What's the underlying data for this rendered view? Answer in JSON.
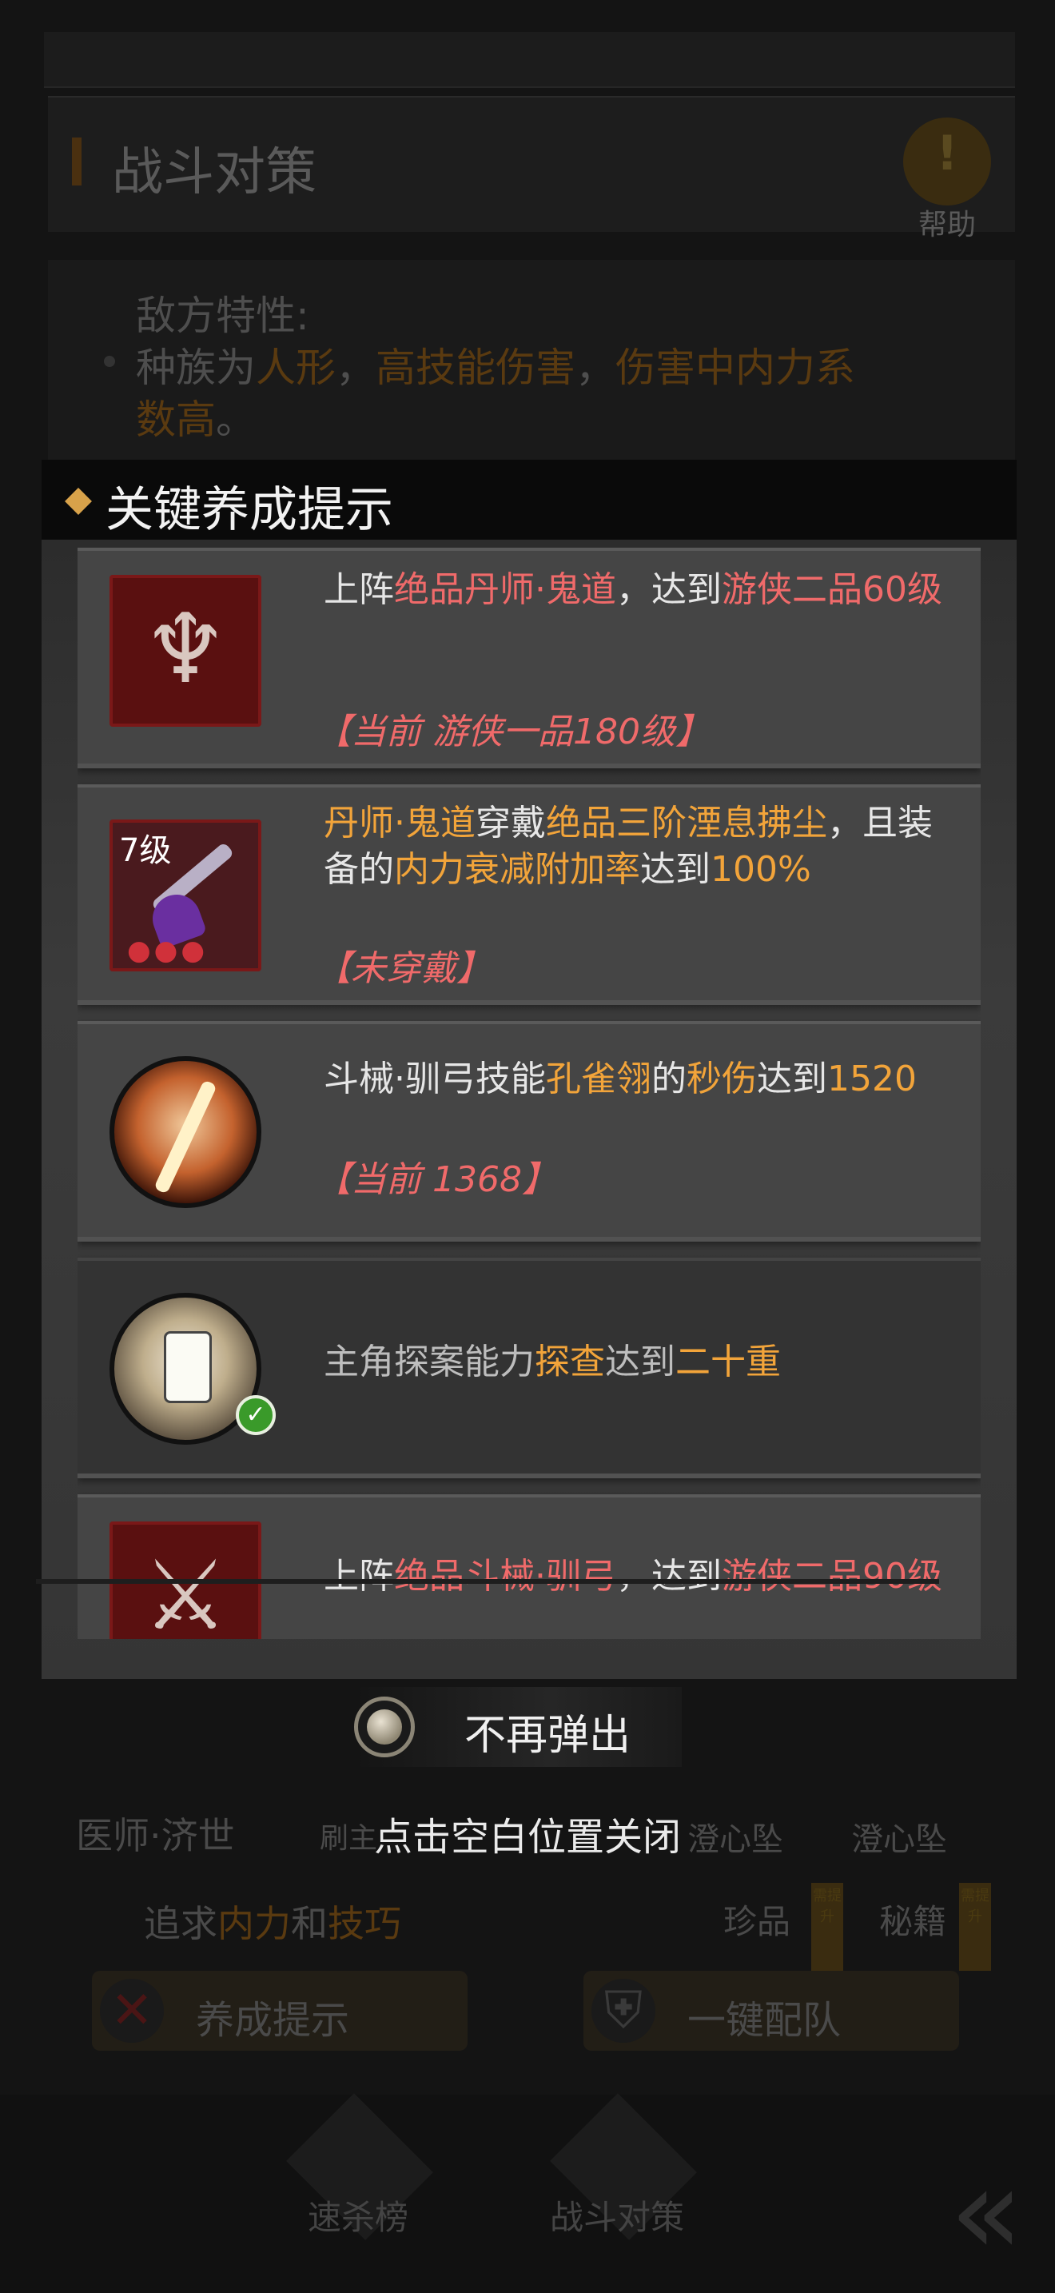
{
  "background": {
    "header_title": "战斗对策",
    "help_label": "帮助",
    "enemy_traits": {
      "label": "敌方特性:",
      "line1_prefix": "种族为",
      "race": "人形",
      "sep1": "，",
      "trait_a": "高技能伤害",
      "sep2": "，",
      "trait_b": "伤害中内力系",
      "line2_cont": "数高",
      "line2_end": "。"
    },
    "role_left": "医师·济世",
    "role_mid1": "刷主",
    "role_mid2": "澄心坠",
    "role_right": "澄心坠",
    "pursuit_prefix": "追求",
    "pursuit_a": "内力",
    "pursuit_and": "和",
    "pursuit_b": "技巧",
    "tag_treasure": "珍品",
    "tag_manual": "秘籍",
    "mini_tag": "需提升",
    "btn_cultivate": "养成提示",
    "btn_auto_team": "一键配队",
    "nav_ranking": "速杀榜",
    "nav_strategy": "战斗对策"
  },
  "modal": {
    "title": "关键养成提示",
    "cards": [
      {
        "icon": "guidao-emblem-icon",
        "t1": "上阵",
        "t2": "绝品丹师·鬼道",
        "t3": "，达到",
        "t4": "游侠二品60级",
        "status": "【当前 游侠一品180级】"
      },
      {
        "icon": "whisk-weapon-icon",
        "level": "7级",
        "t1": "丹师·鬼道",
        "t2": "穿戴",
        "t3": "绝品三阶湮息拂尘",
        "t4": "，且装备的",
        "t5": "内力衰减附加率",
        "t6": "达到",
        "t7": "100%",
        "status": "【未穿戴】"
      },
      {
        "icon": "peacock-feather-skill-icon",
        "t1": "斗械·驯弓技能",
        "t2": "孔雀翎",
        "t3": "的",
        "t4": "秒伤",
        "t5": "达到",
        "t6": "1520",
        "status": "【当前 1368】"
      },
      {
        "icon": "investigation-lantern-icon",
        "t1": "主角探案能力",
        "t2": "探查",
        "t3": "达到",
        "t4": "二十重"
      },
      {
        "icon": "xungong-emblem-icon",
        "t1": "上阵",
        "t2": "绝品斗械·驯弓",
        "t3": "，达到",
        "t4": "游侠二品90级"
      }
    ],
    "no_popup_label": "不再弹出",
    "close_hint": "点击空白位置关闭"
  },
  "colors": {
    "accent_yellow": "#f2a43a",
    "accent_red": "#f06a6a",
    "check_green": "#3a9a2a"
  }
}
